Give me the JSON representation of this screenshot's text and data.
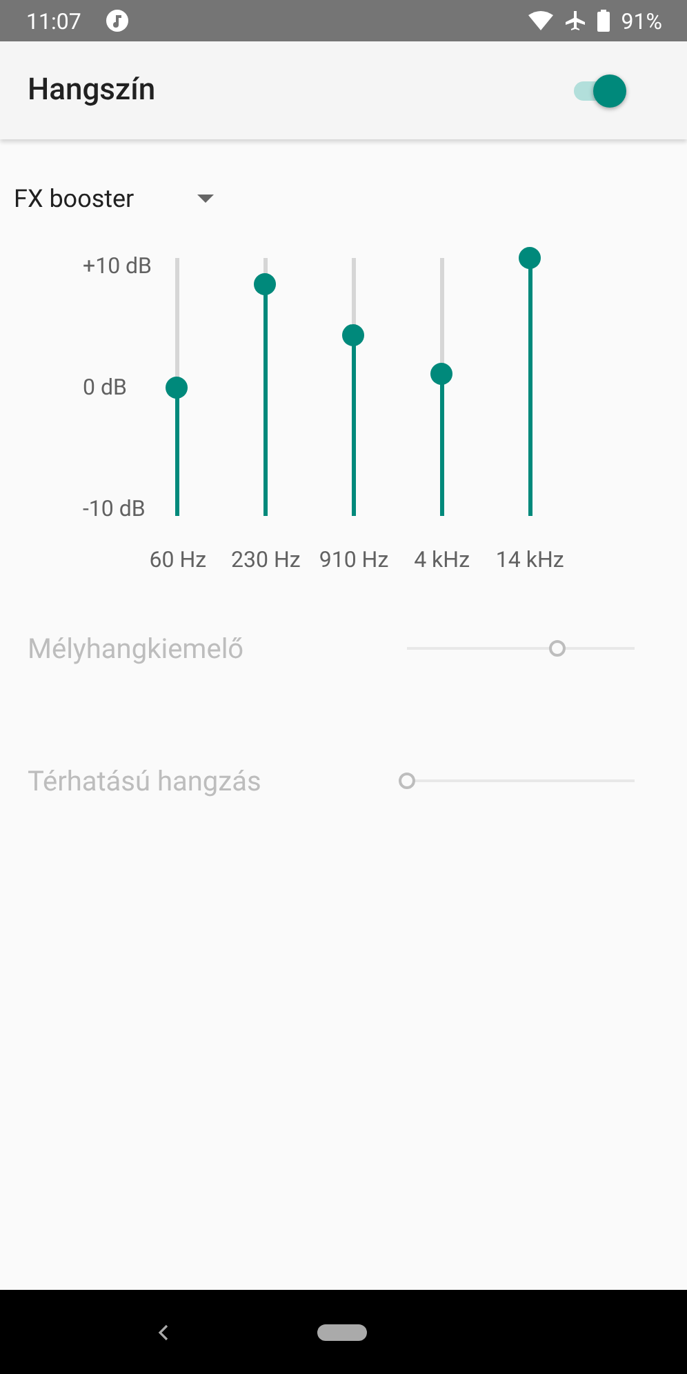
{
  "status_bar": {
    "time": "11:07",
    "battery": "91%"
  },
  "app_bar": {
    "title": "Hangszín",
    "switch": {
      "on": true
    }
  },
  "preset": {
    "value": "FX booster"
  },
  "equalizer": {
    "axis_labels": [
      "+10 dB",
      "0 dB",
      "-10 dB"
    ],
    "bands": [
      {
        "label": "60 Hz",
        "level": 0.5
      },
      {
        "label": "230 Hz",
        "level": 0.9
      },
      {
        "label": "910 Hz",
        "level": 0.7
      },
      {
        "label": "4 kHz",
        "level": 0.55
      },
      {
        "label": "14 kHz",
        "level": 1.0
      }
    ]
  },
  "effects": [
    {
      "label": "Mélyhangkiemelő",
      "level": 0.66,
      "disabled": true
    },
    {
      "label": "Térhatású hangzás",
      "level": 0,
      "disabled": true
    }
  ]
}
